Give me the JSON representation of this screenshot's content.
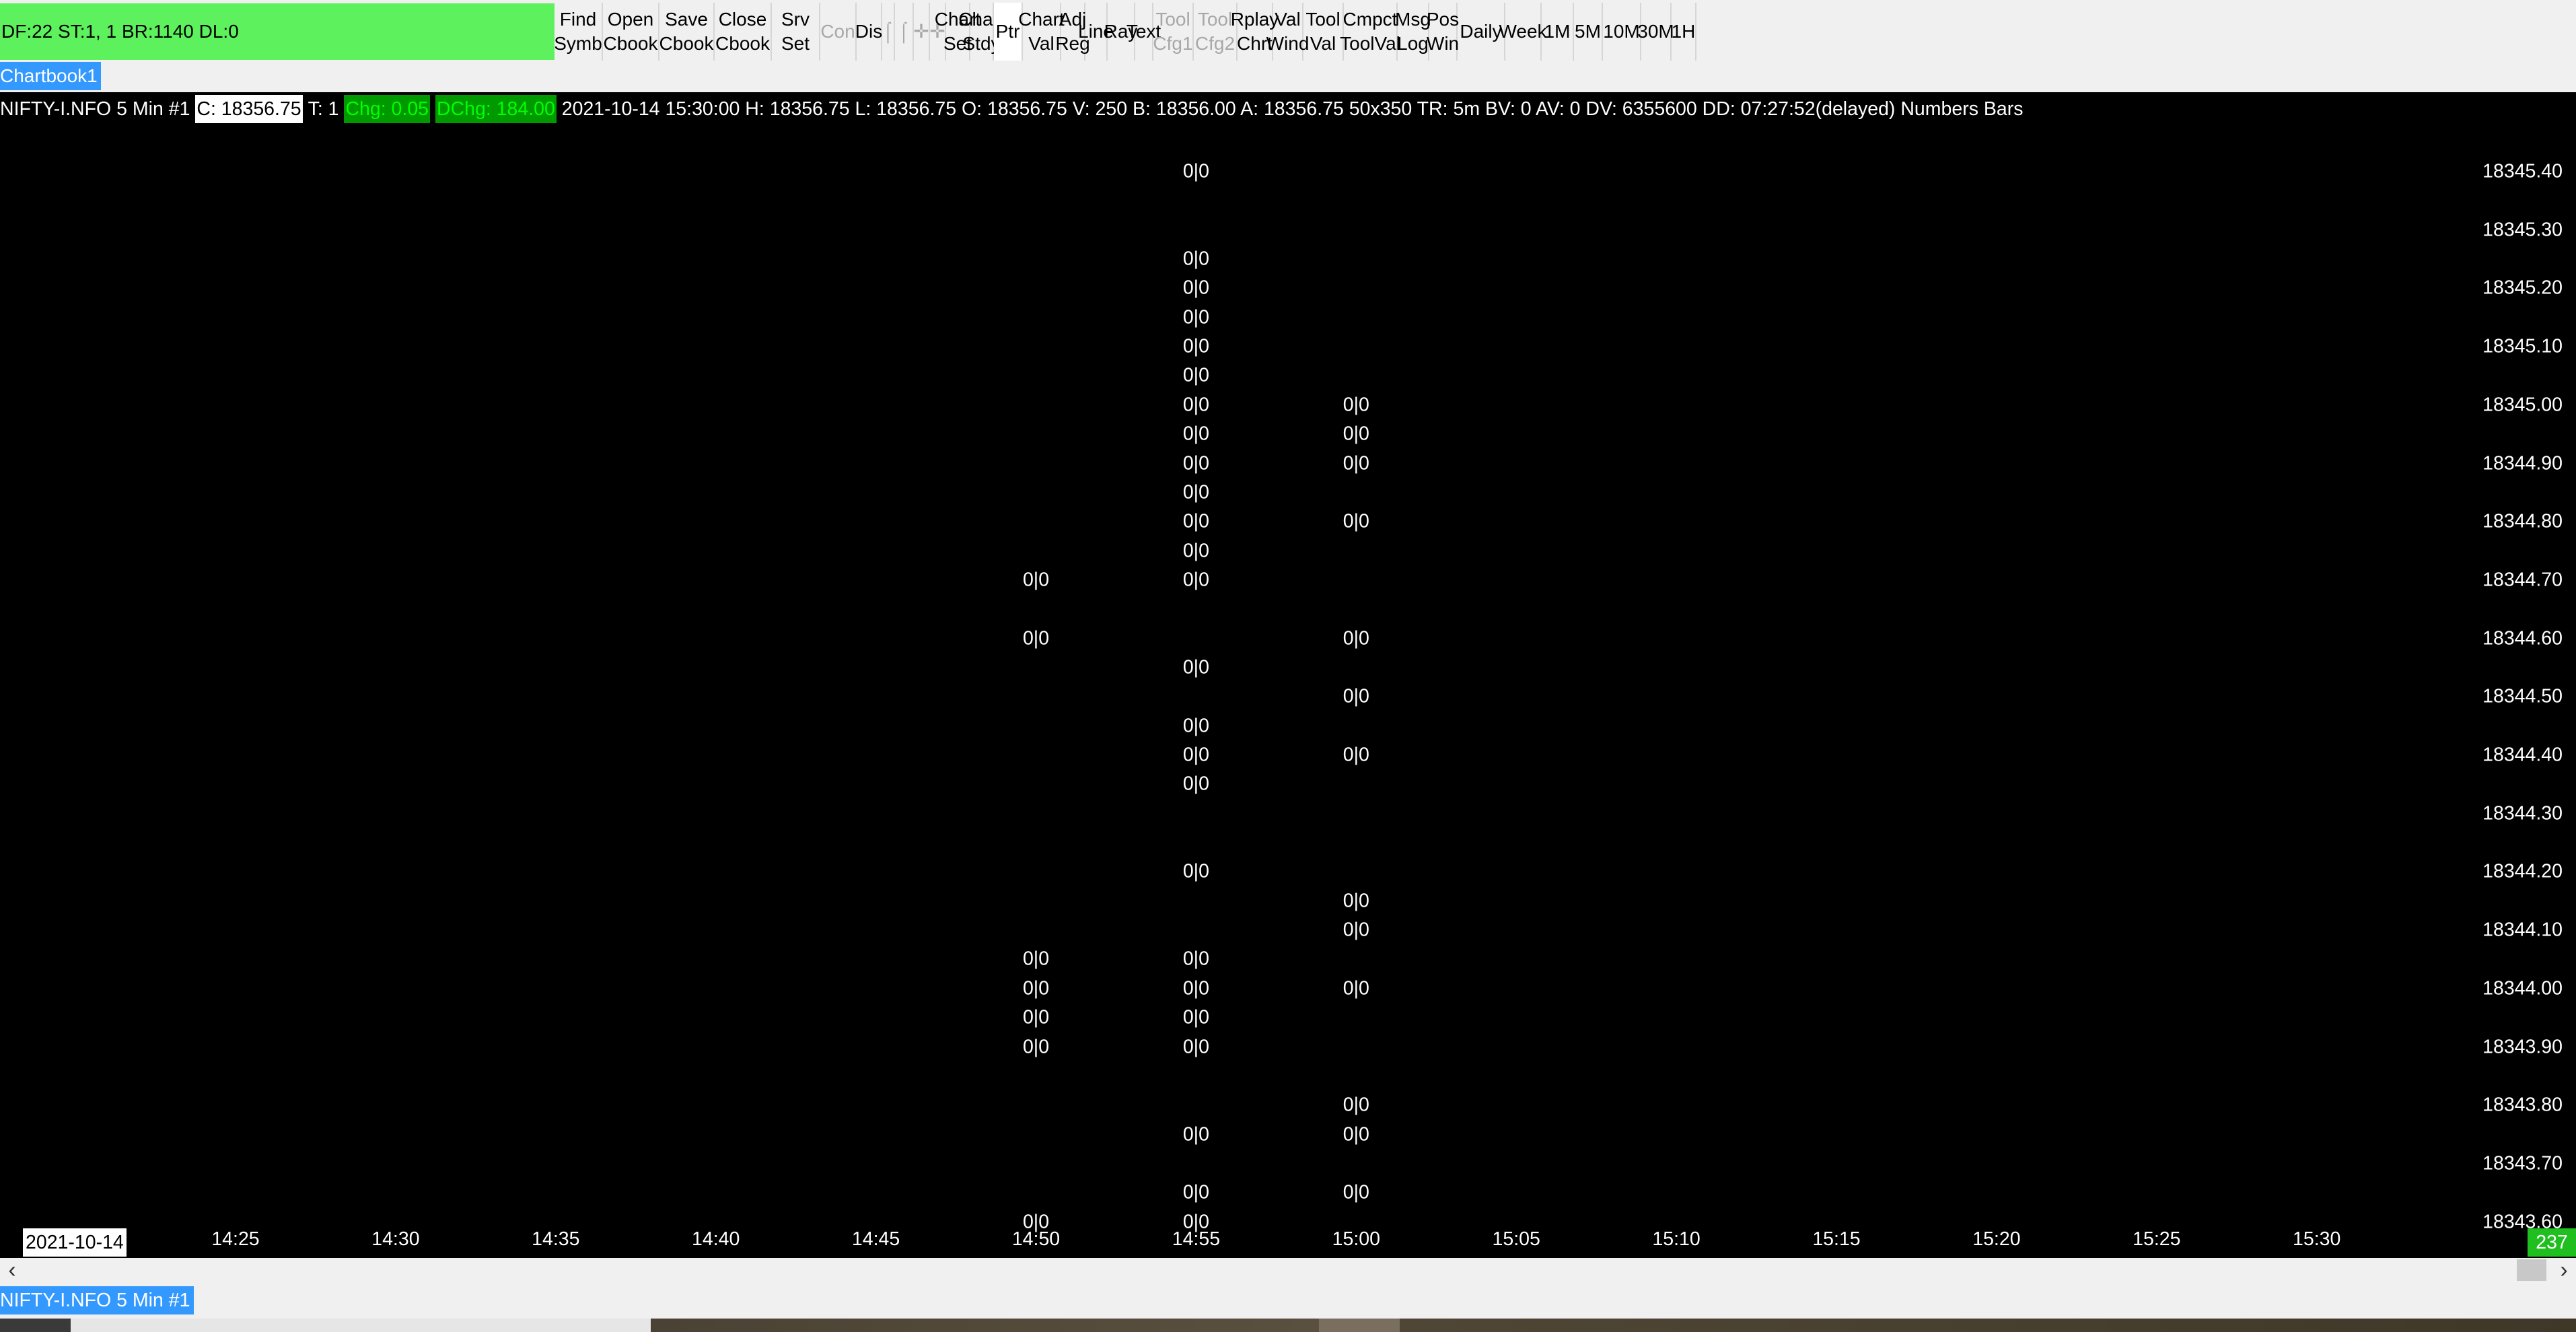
{
  "toolbar": {
    "status_text": "DF:22  ST:1, 1  BR:1140  DL:0",
    "buttons": [
      {
        "id": "find-symbol",
        "l1": "Find",
        "l2": "Symb",
        "enabled": true
      },
      {
        "id": "open-chartbook",
        "l1": "Open",
        "l2": "Cbook",
        "enabled": true
      },
      {
        "id": "save-chartbook",
        "l1": "Save",
        "l2": "Cbook",
        "enabled": true
      },
      {
        "id": "close-chartbook",
        "l1": "Close",
        "l2": "Cbook",
        "enabled": true
      },
      {
        "id": "server-settings",
        "l1": "Srv",
        "l2": "Set",
        "enabled": true
      },
      {
        "id": "connect",
        "l1": "Con",
        "l2": "",
        "enabled": false
      },
      {
        "id": "disconnect",
        "l1": "Dis",
        "l2": "",
        "enabled": true
      },
      {
        "id": "crosshair-1",
        "l1": "⌠",
        "l2": "",
        "enabled": false,
        "glyph": true
      },
      {
        "id": "crosshair-2",
        "l1": "⌠",
        "l2": "",
        "enabled": false,
        "glyph": true
      },
      {
        "id": "crosshair-3",
        "l1": "✛",
        "l2": "",
        "enabled": false,
        "glyph": true
      },
      {
        "id": "crosshair-4",
        "l1": "✛",
        "l2": "",
        "enabled": false,
        "glyph": true
      },
      {
        "id": "chart-settings",
        "l1": "Chart",
        "l2": "Set",
        "enabled": true
      },
      {
        "id": "chart-studies",
        "l1": "Chart",
        "l2": "Stdy",
        "enabled": true
      },
      {
        "id": "pointer",
        "l1": "Ptr",
        "l2": "",
        "enabled": true,
        "selected": true
      },
      {
        "id": "chart-values",
        "l1": "Chart",
        "l2": "Val",
        "enabled": true
      },
      {
        "id": "adjust-region",
        "l1": "Adj",
        "l2": "Reg",
        "enabled": true
      },
      {
        "id": "line-tool",
        "l1": "Line",
        "l2": "",
        "enabled": true
      },
      {
        "id": "ray-tool",
        "l1": "Ray",
        "l2": "",
        "enabled": true
      },
      {
        "id": "text-tool",
        "l1": "Text",
        "l2": "",
        "enabled": true
      },
      {
        "id": "tool-config-1",
        "l1": "Tool",
        "l2": "Cfg1",
        "enabled": false
      },
      {
        "id": "tool-config-2",
        "l1": "Tool",
        "l2": "Cfg2",
        "enabled": false
      },
      {
        "id": "replay-chart",
        "l1": "Rplay",
        "l2": "Chrt",
        "enabled": true
      },
      {
        "id": "values-window",
        "l1": "Val",
        "l2": "Wind",
        "enabled": true
      },
      {
        "id": "tool-values",
        "l1": "Tool",
        "l2": "Val",
        "enabled": true
      },
      {
        "id": "compact-tool-values",
        "l1": "Cmpct",
        "l2": "ToolVal",
        "enabled": true
      },
      {
        "id": "message-log",
        "l1": "Msg",
        "l2": "Log",
        "enabled": true
      },
      {
        "id": "position-window",
        "l1": "Pos",
        "l2": "Win",
        "enabled": true
      },
      {
        "id": "daily",
        "l1": "Daily",
        "l2": "",
        "enabled": true
      },
      {
        "id": "weekly",
        "l1": "Week",
        "l2": "",
        "enabled": true
      },
      {
        "id": "interval-1m",
        "l1": "1M",
        "l2": "",
        "enabled": true
      },
      {
        "id": "interval-5m",
        "l1": "5M",
        "l2": "",
        "enabled": true
      },
      {
        "id": "interval-10m",
        "l1": "10M",
        "l2": "",
        "enabled": true
      },
      {
        "id": "interval-30m",
        "l1": "30M",
        "l2": "",
        "enabled": true
      },
      {
        "id": "interval-1h",
        "l1": "1H",
        "l2": "",
        "enabled": true
      }
    ]
  },
  "chartbook_tab": "Chartbook1",
  "info": {
    "symbol": "NIFTY-I.NFO  5 Min   #1",
    "close": "C: 18356.75",
    "trades": "T: 1",
    "change": "Chg: 0.05",
    "daily_change": "DChg: 184.00",
    "details": "2021-10-14 15:30:00 H: 18356.75 L: 18356.75 O: 18356.75 V: 250 B: 18356.00 A: 18356.75 50x350 TR: 5m BV: 0 AV: 0 DV: 6355600 DD: 07:27:52(delayed) Numbers Bars"
  },
  "price_labels": [
    "18345.40",
    "18345.30",
    "18345.20",
    "18345.10",
    "18345.00",
    "18344.90",
    "18344.80",
    "18344.70",
    "18344.60",
    "18344.50",
    "18344.40",
    "18344.30",
    "18344.20",
    "18344.10",
    "18344.00",
    "18343.90",
    "18343.80",
    "18343.70",
    "18343.60"
  ],
  "time_labels": [
    "14:25",
    "14:30",
    "14:35",
    "14:40",
    "14:45",
    "14:50",
    "14:55",
    "15:00",
    "15:05",
    "15:10",
    "15:15",
    "15:20",
    "15:25",
    "15:30"
  ],
  "date_label": "2021-10-14",
  "bar_count": "237",
  "cell_text": "0|0",
  "number_bars": [
    {
      "time": "14:50",
      "prices": [
        18344.7,
        18344.6,
        18344.05,
        18344.0,
        18343.95,
        18343.9,
        18343.6
      ]
    },
    {
      "time": "14:55",
      "prices": [
        18345.4,
        18345.25,
        18345.2,
        18345.15,
        18345.1,
        18345.05,
        18345.0,
        18344.95,
        18344.9,
        18344.85,
        18344.8,
        18344.75,
        18344.7,
        18344.55,
        18344.45,
        18344.4,
        18344.35,
        18344.2,
        18344.05,
        18344.0,
        18343.95,
        18343.9,
        18343.75,
        18343.65,
        18343.6
      ]
    },
    {
      "time": "15:00",
      "prices": [
        18345.0,
        18344.95,
        18344.9,
        18344.8,
        18344.6,
        18344.5,
        18344.4,
        18344.15,
        18344.1,
        18344.0,
        18343.8,
        18343.75,
        18343.65
      ]
    }
  ],
  "bottom_tab": "NIFTY-I.NFO  5 Min   #1"
}
